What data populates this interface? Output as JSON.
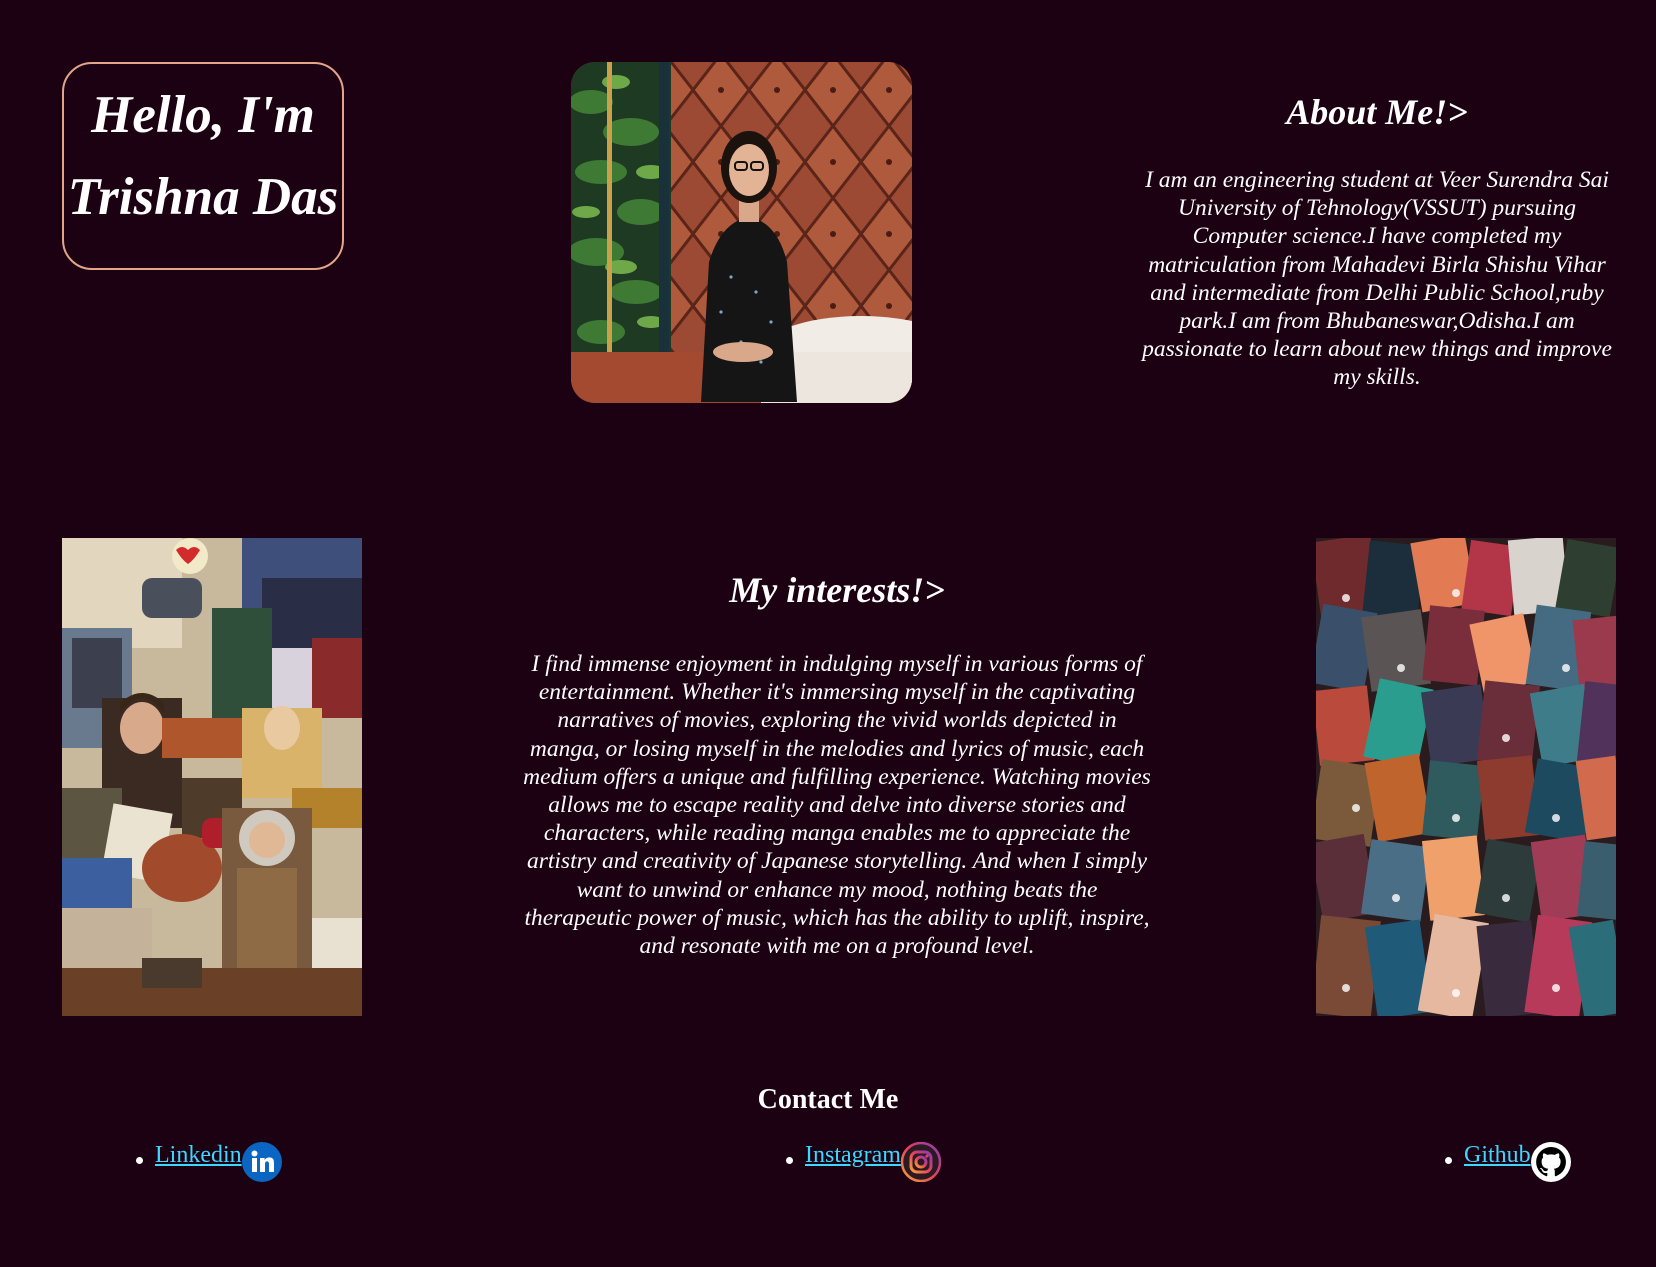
{
  "hero": {
    "line1": "Hello, I'm",
    "line2": "Trishna Das"
  },
  "about": {
    "heading": "About Me!>",
    "text": "I am an engineering student at Veer Surendra Sai University of Tehnology(VSSUT) pursuing Computer science.I have completed my matriculation from Mahadevi Birla Shishu Vihar and intermediate from Delhi Public School,ruby park.I am from Bhubaneswar,Odisha.I am passionate to learn about new things and improve my skills."
  },
  "interests": {
    "heading": "My interests!>",
    "text": "I find immense enjoyment in indulging myself in various forms of entertainment. Whether it's immersing myself in the captivating narratives of movies, exploring the vivid worlds depicted in manga, or losing myself in the melodies and lyrics of music, each medium offers a unique and fulfilling experience. Watching movies allows me to escape reality and delve into diverse stories and characters, while reading manga enables me to appreciate the artistry and creativity of Japanese storytelling. And when I simply want to unwind or enhance my mood, nothing beats the therapeutic power of music, which has the ability to uplift, inspire, and resonate with me on a profound level."
  },
  "contact": {
    "heading": "Contact Me",
    "links": [
      {
        "label": "Linkedin",
        "icon": "linkedin-icon"
      },
      {
        "label": "Instagram",
        "icon": "instagram-icon"
      },
      {
        "label": "Github",
        "icon": "github-icon"
      }
    ]
  },
  "colors": {
    "background": "#1c0112",
    "text": "#ffffff",
    "name_box_border": "#e3a58a",
    "link": "#3fd6ff",
    "linkedin_blue": "#0a66c2"
  },
  "images": {
    "profile": "profile-photo",
    "collage_left": "movie-collage",
    "collage_right": "music-collage"
  }
}
